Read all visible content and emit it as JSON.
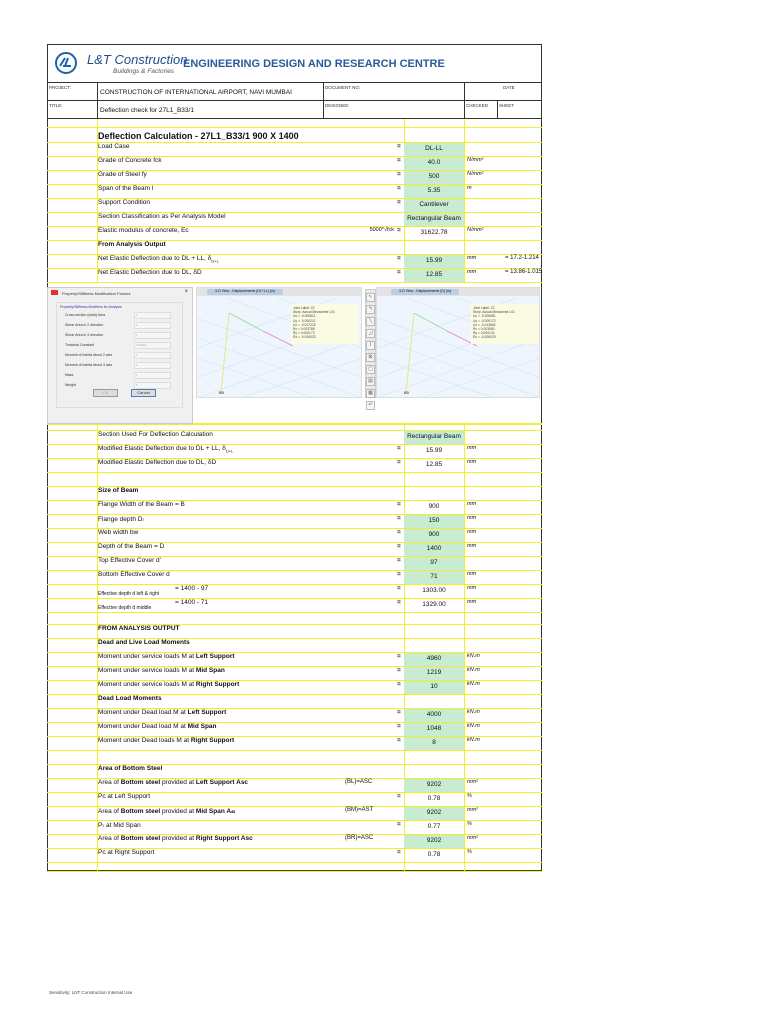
{
  "header": {
    "company": "L&T Construction",
    "division": "Buildings & Factories",
    "centre": "ENGINEERING DESIGN AND RESEARCH CENTRE",
    "project_label": "PROJECT:",
    "project": "CONSTRUCTION OF INTERNATIONAL AIRPORT, NAVI MUMBAI",
    "document_no_label": "DOCUMENT NO:",
    "date_label": "DATE",
    "title_label": "TITLE:",
    "title": "Deflection check for 27L1_B33/1",
    "designed_label": "DESIGNED",
    "checked_label": "CHECKED",
    "sheet_label": "SHEET"
  },
  "sections": [
    {
      "rows": [
        {
          "l": "Deflection Calculation - 27L1_B33/1 900 X 1400",
          "kind": "title"
        },
        {
          "l": "Load Case",
          "eq": "=",
          "v": "DL-LL",
          "g": true
        },
        {
          "l": "Grade of Concrete fck",
          "eq": "=",
          "v": "40.0",
          "g": true,
          "u": "N/mm²"
        },
        {
          "l": "Grade of Steel fy",
          "eq": "=",
          "v": "500",
          "g": true,
          "u": "N/mm²"
        },
        {
          "l": "Span of the Beam l",
          "eq": "=",
          "v": "5.35",
          "g": true,
          "u": "m"
        },
        {
          "l": "Support Condition",
          "eq": "=",
          "v": "Cantilever",
          "g": true
        },
        {
          "l": "Section Classification as Per Analysis Model",
          "v": "Rectangular Beam",
          "g": true
        },
        {
          "l": "Elastic modulus of concrete, Ec",
          "fr": "5000*√fck",
          "eq": "=",
          "v": "31622.78",
          "u": "N/mm²"
        },
        {
          "l": "From Analysis Output",
          "kind": "head"
        },
        {
          "l": "Net Elastic Deflection due to DL + LL, δ",
          "sub": "D+L",
          "eq": "=",
          "v": "15.99",
          "g": true,
          "u": "mm",
          "n": "= 17.2-1.214"
        },
        {
          "l": "Net Elastic Deflection due to DL, δD",
          "eq": "=",
          "v": "12.85",
          "g": true,
          "u": "mm",
          "n": "= 13.86-1.015"
        }
      ]
    },
    {
      "rows": [
        {
          "l": "Section Used For Deflection Calculation",
          "v": "Rectangular Beam",
          "g": true
        },
        {
          "l": "Modified Elastic Deflection due to DL + LL, δ",
          "sub": "D+L",
          "eq": "=",
          "v": "15.99",
          "u": "mm"
        },
        {
          "l": "Modified Elastic Deflection due to DL, δD",
          "eq": "=",
          "v": "12.85",
          "u": "mm"
        }
      ]
    },
    {
      "rows": [
        {
          "l": "Size of Beam",
          "kind": "head"
        },
        {
          "l": "Flange Width of the Beam = B",
          "eq": "=",
          "v": "900",
          "u": "mm"
        },
        {
          "l": "Flange depth Dₗ",
          "eq": "=",
          "v": "150",
          "g": true,
          "u": "mm"
        },
        {
          "l": "Web width bw",
          "eq": "=",
          "v": "900",
          "g": true,
          "u": "mm"
        },
        {
          "l": "Depth of the Beam = D",
          "eq": "=",
          "v": "1400",
          "g": true,
          "u": "mm"
        },
        {
          "l": "Top Effective Cover d'",
          "eq": "=",
          "v": "97",
          "g": true
        },
        {
          "l": "Bottom Effective Cover d",
          "eq": "=",
          "v": "71",
          "g": true,
          "u": "mm"
        },
        {
          "l": "Effective depth d left & right",
          "kind": "small",
          "fm": "= 1400 - 97",
          "eq": "=",
          "v": "1303.00",
          "u": "mm"
        },
        {
          "l": "Effective depth d middle",
          "kind": "small",
          "fm": "= 1400 - 71",
          "eq": "=",
          "v": "1329.00",
          "u": "mm"
        }
      ]
    },
    {
      "rows": [
        {
          "l": "FROM ANALYSIS OUTPUT",
          "kind": "head"
        },
        {
          "l": "Dead and Live Load Moments",
          "kind": "head"
        },
        {
          "l": "Moment under service loads M at ",
          "b": "Left Support",
          "eq": "=",
          "v": "4960",
          "g": true,
          "u": "kN.m"
        },
        {
          "l": "Moment under service loads M at ",
          "b": "Mid Span",
          "eq": "=",
          "v": "1219",
          "g": true,
          "u": "kN.m"
        },
        {
          "l": "Moment under service loads M at ",
          "b": "Right Support",
          "eq": "=",
          "v": "10",
          "g": true,
          "u": "kN.m"
        },
        {
          "l": "Dead  Load Moments",
          "kind": "head"
        },
        {
          "l": "Moment under Dead load M at ",
          "b": "Left Support",
          "eq": "=",
          "v": "4000",
          "g": true,
          "u": "kN.m"
        },
        {
          "l": "Moment under Dead load M at ",
          "b": "Mid Span",
          "eq": "=",
          "v": "1048",
          "g": true,
          "u": "kN.m"
        },
        {
          "l": "Moment under Dead loads M at ",
          "b": "Right Support",
          "eq": "=",
          "v": "8",
          "g": true,
          "u": "kN.m"
        }
      ]
    },
    {
      "rows": [
        {
          "l": "Area of Bottom Steel",
          "kind": "head"
        },
        {
          "l": "Area of ",
          "b": "Bottom steel",
          "l2": " provided at ",
          "b2": "Left Support Asc",
          "fc": "(BL)=ASC",
          "v": "9202",
          "g": true,
          "u": "mm²"
        },
        {
          "l": "Pc at Left Support",
          "eq": "=",
          "v": "0.78",
          "u": "%"
        },
        {
          "l": "Area of ",
          "b": "Bottom steel",
          "l2": " provided at ",
          "b2": "Mid Span Aₛₜ",
          "fc": "(BM)=AST",
          "v": "9202",
          "g": true,
          "u": "mm²"
        },
        {
          "l": "Pₜ at Mid Span",
          "eq": "=",
          "v": "0.77",
          "u": "%"
        },
        {
          "l": "Area of ",
          "b": "Bottom steel",
          "l2": " provided at ",
          "b2": "Right Support Asc",
          "fc": "(BR)=ASC",
          "v": "9202",
          "g": true,
          "u": "mm²"
        },
        {
          "l": "Pc at Right Support",
          "eq": "=",
          "v": "0.78",
          "u": "%"
        }
      ]
    }
  ],
  "embedded_screenshot": {
    "dialog_title": "Property/Stiffness Modification Factors",
    "dialog_subtitle": "Property/Stiffness Modifiers for Analysis",
    "items": [
      {
        "label": "Cross-section (axial) Area",
        "value": "1"
      },
      {
        "label": "Shear Area in 2 direction",
        "value": "1"
      },
      {
        "label": "Shear Area in 3 direction",
        "value": "1"
      },
      {
        "label": "Torsional Constant",
        "value": "0.00001"
      },
      {
        "label": "Moment of Inertia about 2 axis",
        "value": "1"
      },
      {
        "label": "Moment of Inertia about 3 axis",
        "value": "1"
      },
      {
        "label": "Mass",
        "value": "1"
      },
      {
        "label": "Weight",
        "value": "1"
      }
    ],
    "ok": "OK",
    "cancel": "Cancel",
    "view1_tab": "3-D View - Displacements (DL+LL) [m]",
    "view1_tip": [
      "Joint Label: 22",
      "Story: Actual Mezzanine L01",
      "Ux = -0.000811",
      "Uy = -0.000211",
      "Uz = -0.017215",
      "Rx = 0.003785",
      "Ry = 0.000173",
      "Rz = -0.000033"
    ],
    "view2_tab": "3-D View - Displacements (D) [m]",
    "view2_tip": [
      "Joint Label: 22",
      "Story: Actual Mezzanine L01",
      "Ux = -0.000681",
      "Uy = -0.000172",
      "Uz = -0.013862",
      "Rx = 0.003060",
      "Ry = 0.000142",
      "Rz = -0.000025"
    ],
    "grid_label_1": "B5",
    "grid_label_2": "B5"
  },
  "footer": "Sensitivity: LNT Construction Internal Use"
}
